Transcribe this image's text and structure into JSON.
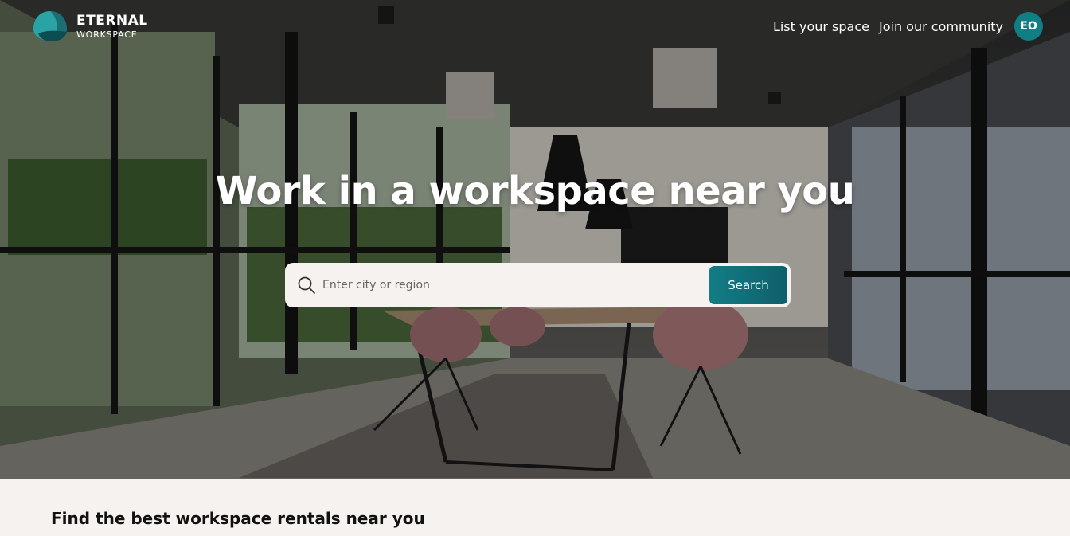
{
  "brand": {
    "name_line1": "ETERNAL",
    "name_line2": "WORKSPACE",
    "colors": {
      "primary": "#0f7f84",
      "primary_dark": "#0f5f6a",
      "logo_light": "#2aa3a6"
    }
  },
  "nav": {
    "items": [
      {
        "label": "List your space"
      },
      {
        "label": "Join our community"
      }
    ],
    "avatar_initials": "EO"
  },
  "hero": {
    "headline": "Work in a workspace near you",
    "search": {
      "placeholder": "Enter city or region",
      "value": "",
      "icon": "search-icon",
      "button_label": "Search"
    },
    "background_scene": "office-meeting-room-photo"
  },
  "section": {
    "title": "Find the best workspace rentals near you"
  }
}
